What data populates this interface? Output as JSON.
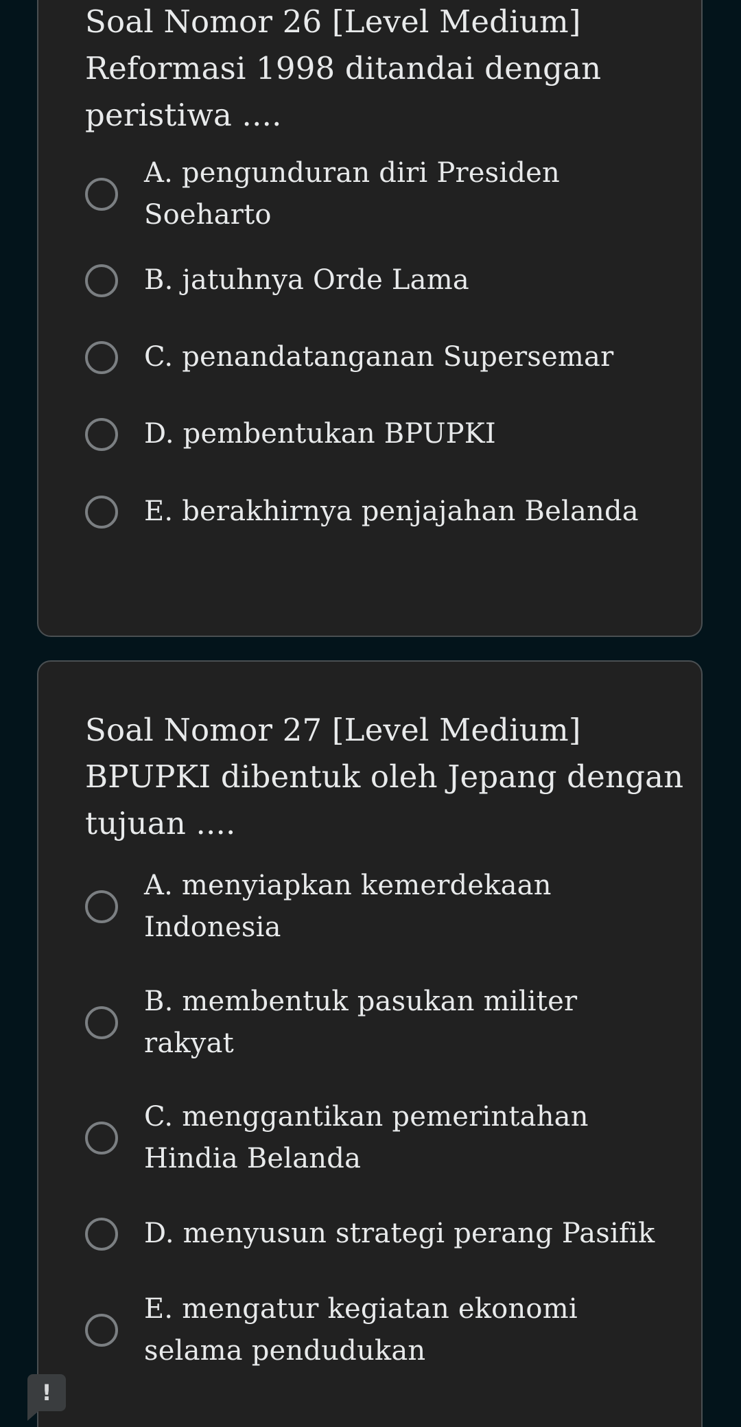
{
  "questions": [
    {
      "title": "Soal Nomor 26 [Level Medium]",
      "text_line1": "Reformasi 1998 ditandai dengan",
      "text_line2": "peristiwa ....",
      "options": [
        {
          "line1": "A. pengunduran diri Presiden",
          "line2": "Soeharto"
        },
        {
          "line1": "B. jatuhnya Orde Lama"
        },
        {
          "line1": "C. penandatanganan Supersemar"
        },
        {
          "line1": "D. pembentukan BPUPKI"
        },
        {
          "line1": "E. berakhirnya penjajahan Belanda"
        }
      ]
    },
    {
      "title": "Soal Nomor 27 [Level Medium]",
      "text_line1": "BPUPKI dibentuk oleh Jepang dengan",
      "text_line2": "tujuan ....",
      "options": [
        {
          "line1": "A. menyiapkan kemerdekaan",
          "line2": "Indonesia"
        },
        {
          "line1": "B. membentuk pasukan militer",
          "line2": "rakyat"
        },
        {
          "line1": "C. menggantikan pemerintahan",
          "line2": "Hindia Belanda"
        },
        {
          "line1": "D. menyusun strategi perang Pasifik"
        },
        {
          "line1": "E. mengatur kegiatan ekonomi",
          "line2": "selama pendudukan"
        }
      ]
    }
  ],
  "feedback_button": {
    "icon": "exclamation-icon",
    "glyph": "!"
  },
  "colors": {
    "background": "#03141b",
    "card": "#212121",
    "card_border": "#4a4f52",
    "text": "#e8eaeb",
    "radio_border": "#7b7f82"
  }
}
